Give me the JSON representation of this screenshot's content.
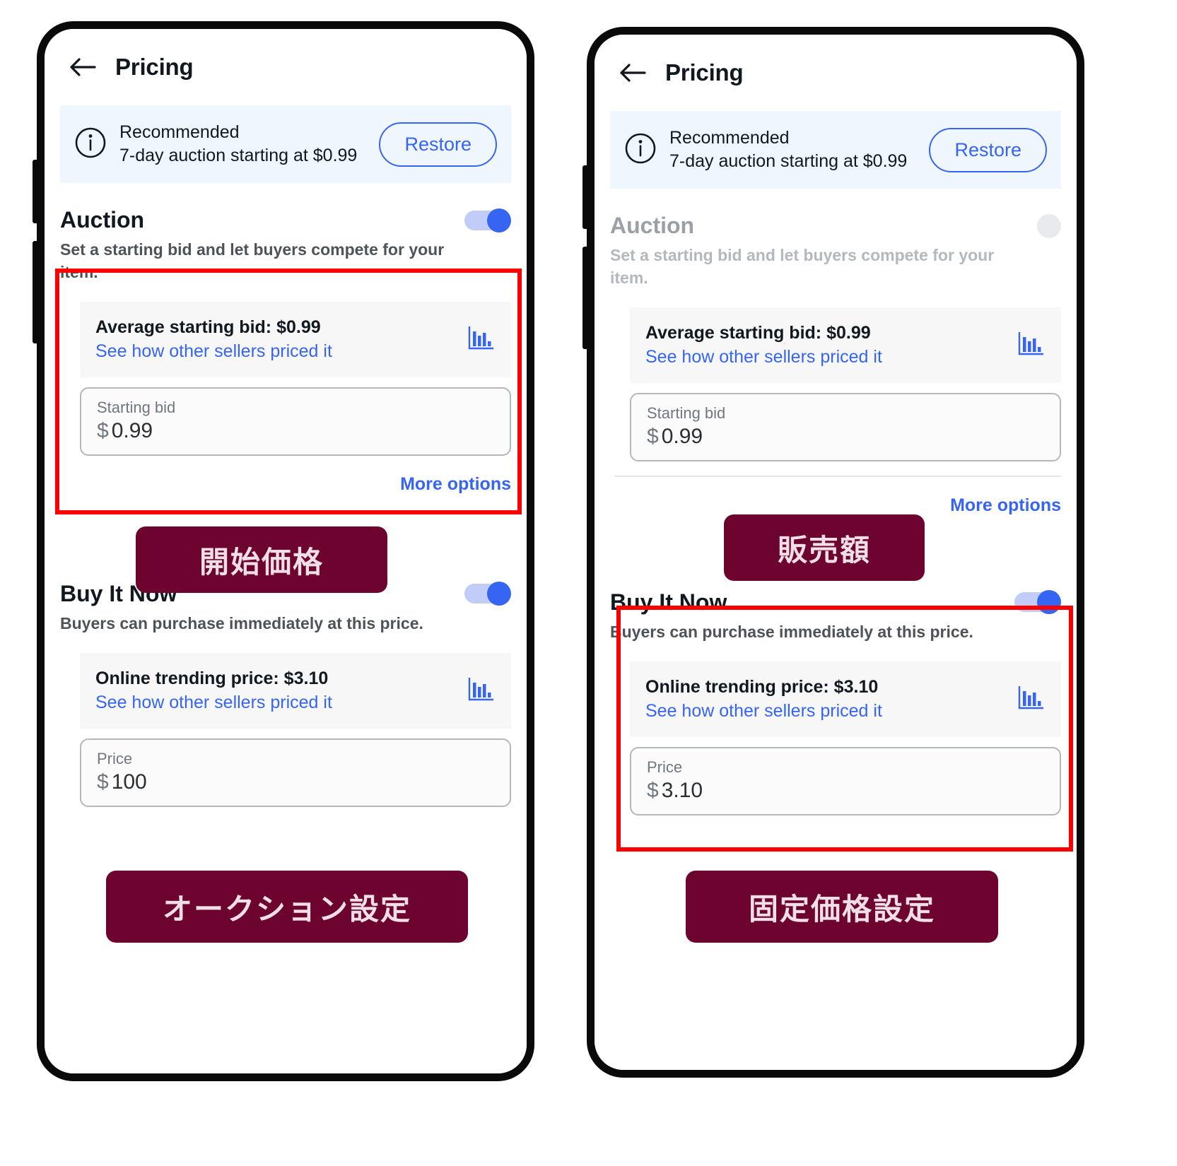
{
  "app": {
    "title": "Pricing",
    "back_icon": "back-arrow-icon"
  },
  "colors": {
    "accent_blue": "#3665f3",
    "banner_bg": "#eff6fd",
    "strip_bg": "#f7f7f7",
    "annotation_red": "#fb0000",
    "annotation_maroon": "#6d0430",
    "annotation_text": "#f0dfe6",
    "toggle_on": "#3665f3",
    "toggle_track": "#c2cdf7",
    "toggle_off": "#e8eaed"
  },
  "left_phone": {
    "banner": {
      "icon": "info-circle-icon",
      "title": "Recommended",
      "subtitle": "7-day auction starting at $0.99",
      "restore_label": "Restore"
    },
    "auction": {
      "title": "Auction",
      "description": "Set a starting bid and let buyers compete for your item.",
      "toggle_state": "on",
      "info": {
        "highlight": "Average starting bid: $0.99",
        "link": "See how other sellers priced it",
        "icon": "bar-chart-icon"
      },
      "field": {
        "label": "Starting bid",
        "currency": "$",
        "value": "0.99"
      }
    },
    "more_options_label": "More options",
    "buy_it_now": {
      "title": "Buy It Now",
      "description": "Buyers can purchase immediately at this price.",
      "toggle_state": "on",
      "info": {
        "highlight": "Online trending price: $3.10",
        "link": "See how other sellers priced it",
        "icon": "bar-chart-icon"
      },
      "field": {
        "label": "Price",
        "currency": "$",
        "value": "100"
      }
    },
    "annotations": {
      "label_mid": "開始価格",
      "label_bottom": "オークション設定"
    }
  },
  "right_phone": {
    "banner": {
      "icon": "info-circle-icon",
      "title": "Recommended",
      "subtitle": "7-day auction starting at $0.99",
      "restore_label": "Restore"
    },
    "auction": {
      "title": "Auction",
      "description": "Set a starting bid and let buyers compete for your item.",
      "toggle_state": "off",
      "info": {
        "highlight": "Average starting bid: $0.99",
        "link": "See how other sellers priced it",
        "icon": "bar-chart-icon"
      },
      "field": {
        "label": "Starting bid",
        "currency": "$",
        "value": "0.99"
      }
    },
    "more_options_label": "More options",
    "buy_it_now": {
      "title": "Buy It Now",
      "description": "Buyers can purchase immediately at this price.",
      "toggle_state": "on",
      "info": {
        "highlight": "Online trending price: $3.10",
        "link": "See how other sellers priced it",
        "icon": "bar-chart-icon"
      },
      "field": {
        "label": "Price",
        "currency": "$",
        "value": "3.10"
      }
    },
    "annotations": {
      "label_mid": "販売額",
      "label_bottom": "固定価格設定"
    }
  }
}
